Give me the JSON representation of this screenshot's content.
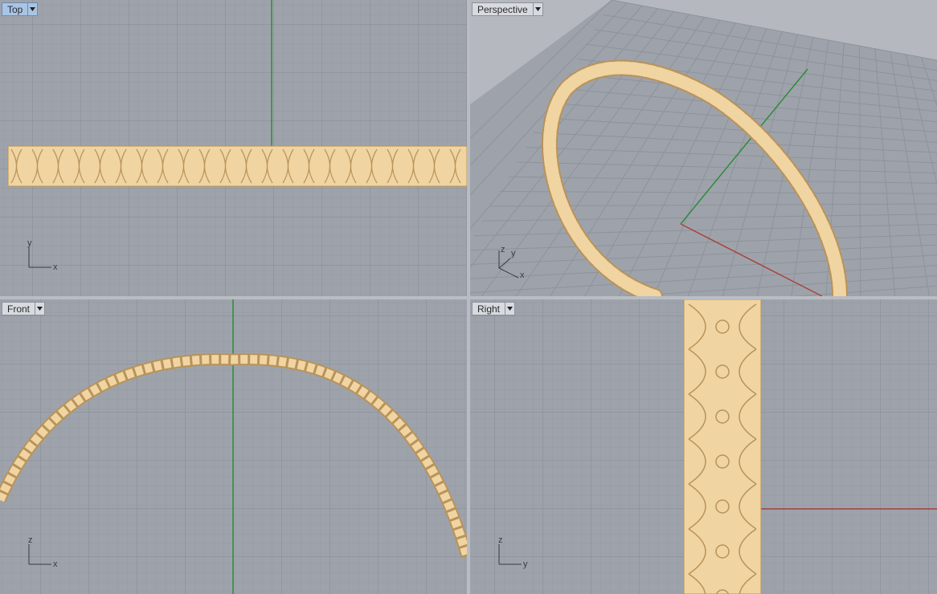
{
  "viewports": {
    "top": {
      "label": "Top",
      "axes": {
        "h": "x",
        "v": "y"
      }
    },
    "perspective": {
      "label": "Perspective",
      "axes": {
        "a": "x",
        "b": "y",
        "c": "z"
      }
    },
    "front": {
      "label": "Front",
      "axes": {
        "h": "x",
        "v": "z"
      }
    },
    "right": {
      "label": "Right",
      "axes": {
        "h": "y",
        "v": "z"
      }
    }
  },
  "colors": {
    "grid_bg": "#9ea3ab",
    "grid_minor": "#959aa2",
    "grid_major": "#83888f",
    "axis_green": "#2e8b3a",
    "axis_red": "#a8453c",
    "gold": "#f0d4a2",
    "gold_dark": "#b8935a",
    "active_tab": "#a9c5e6"
  }
}
